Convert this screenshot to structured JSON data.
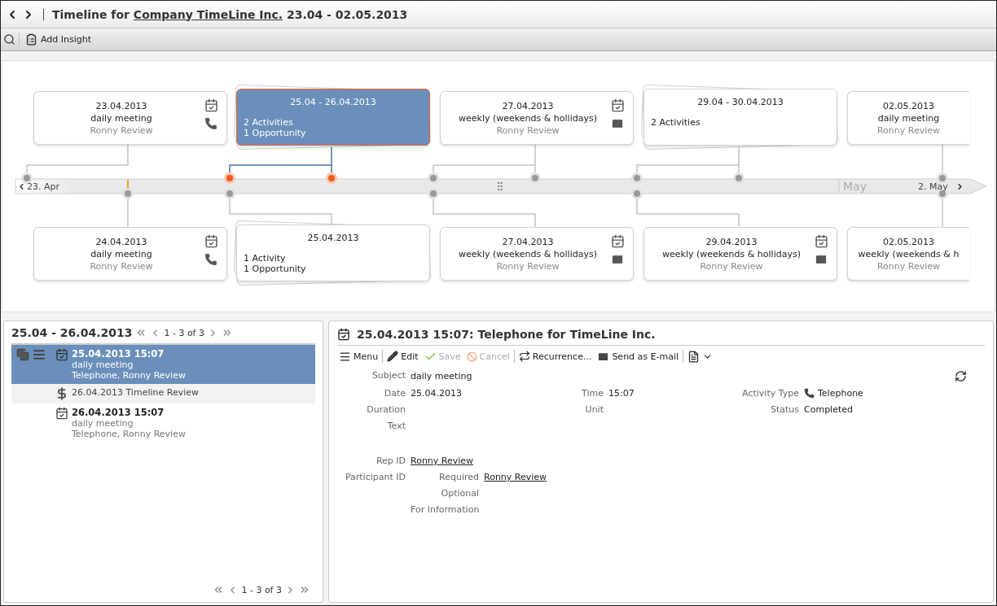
{
  "window": {
    "prefix": "Timeline for",
    "company": "Company TimeLine Inc.",
    "range": "23.04 - 02.05.2013"
  },
  "toolbar": {
    "add_label": "Add Insight"
  },
  "timeline": {
    "start_label": "23. Apr",
    "month_label": "May",
    "end_label": "2. May",
    "top_cards": [
      {
        "kind": "call",
        "selected": false,
        "date": "23.04.2013",
        "subject": "daily meeting",
        "person": "Ronny Review"
      },
      {
        "kind": "group",
        "selected": true,
        "range": "25.04 - 26.04.2013",
        "lines": [
          "2 Activities",
          "1 Opportunity"
        ]
      },
      {
        "kind": "email",
        "selected": false,
        "date": "27.04.2013",
        "subject": "weekly (weekends & hollidays)",
        "person": "Ronny Review"
      },
      {
        "kind": "group",
        "selected": false,
        "range": "29.04 - 30.04.2013",
        "lines": [
          "2 Activities"
        ]
      },
      {
        "kind": "plain",
        "selected": false,
        "date": "02.05.2013",
        "subject": "daily meeting",
        "person": "Ronny Review"
      }
    ],
    "bottom_cards": [
      {
        "kind": "call",
        "selected": false,
        "date": "24.04.2013",
        "subject": "daily meeting",
        "person": "Ronny Review"
      },
      {
        "kind": "group",
        "selected": false,
        "range": "25.04.2013",
        "lines": [
          "1 Activity",
          "1 Opportunity"
        ]
      },
      {
        "kind": "email",
        "selected": false,
        "date": "27.04.2013",
        "subject": "weekly (weekends & hollidays)",
        "person": "Ronny Review"
      },
      {
        "kind": "email",
        "selected": false,
        "date": "29.04.2013",
        "subject": "weekly (weekends & hollidays)",
        "person": "Ronny Review"
      },
      {
        "kind": "plain",
        "selected": false,
        "date": "02.05.2013",
        "subject": "weekly (weekends & h",
        "person": "Ronny Review"
      }
    ]
  },
  "list_panel": {
    "title": "25.04 - 26.04.2013",
    "pager": "1 - 3 of 3",
    "footer_pager": "1 - 3 of 3",
    "items": [
      {
        "kind": "activity",
        "selected": true,
        "title": "25.04.2013 15:07",
        "subject": "daily meeting",
        "detail": "Telephone, Ronny Review"
      },
      {
        "kind": "opportunity",
        "selected": false,
        "title": "26.04.2013 Timeline Review"
      },
      {
        "kind": "activity",
        "selected": false,
        "title": "26.04.2013 15:07",
        "subject": "daily meeting",
        "detail": "Telephone, Ronny Review"
      }
    ]
  },
  "detail_panel": {
    "title": "25.04.2013 15:07: Telephone for TimeLine Inc.",
    "actions": [
      {
        "kind": "button",
        "label": "Menu",
        "disabled": false
      },
      {
        "kind": "separator"
      },
      {
        "kind": "button",
        "label": "Edit",
        "disabled": false
      },
      {
        "kind": "button",
        "label": "Save",
        "disabled": true
      },
      {
        "kind": "button",
        "label": "Cancel",
        "disabled": true
      },
      {
        "kind": "separator"
      },
      {
        "kind": "button",
        "label": "Recurrence...",
        "disabled": false
      },
      {
        "kind": "button",
        "label": "Send as E-mail",
        "disabled": false
      },
      {
        "kind": "separator"
      },
      {
        "kind": "menu_button",
        "disabled": false
      }
    ],
    "field_rows": [
      [
        {
          "label": "Subject",
          "value": "daily meeting"
        }
      ],
      [
        {
          "label": "Date",
          "value": "25.04.2013"
        },
        {
          "label": "Time",
          "value": "15:07"
        },
        {
          "label": "Activity Type",
          "value": "Telephone"
        }
      ],
      [
        {
          "label": "Duration"
        },
        {
          "label": "Unit"
        },
        {
          "label": "Status",
          "value": "Completed"
        }
      ],
      [
        {
          "label": "Text"
        }
      ]
    ],
    "rep": {
      "label": "Rep ID",
      "value": "Ronny Review"
    },
    "participants": {
      "label": "Participant ID",
      "rows": [
        {
          "label": "Required",
          "value": "Ronny Review"
        },
        {
          "label": "Optional"
        },
        {
          "label": "For Information"
        }
      ]
    }
  }
}
